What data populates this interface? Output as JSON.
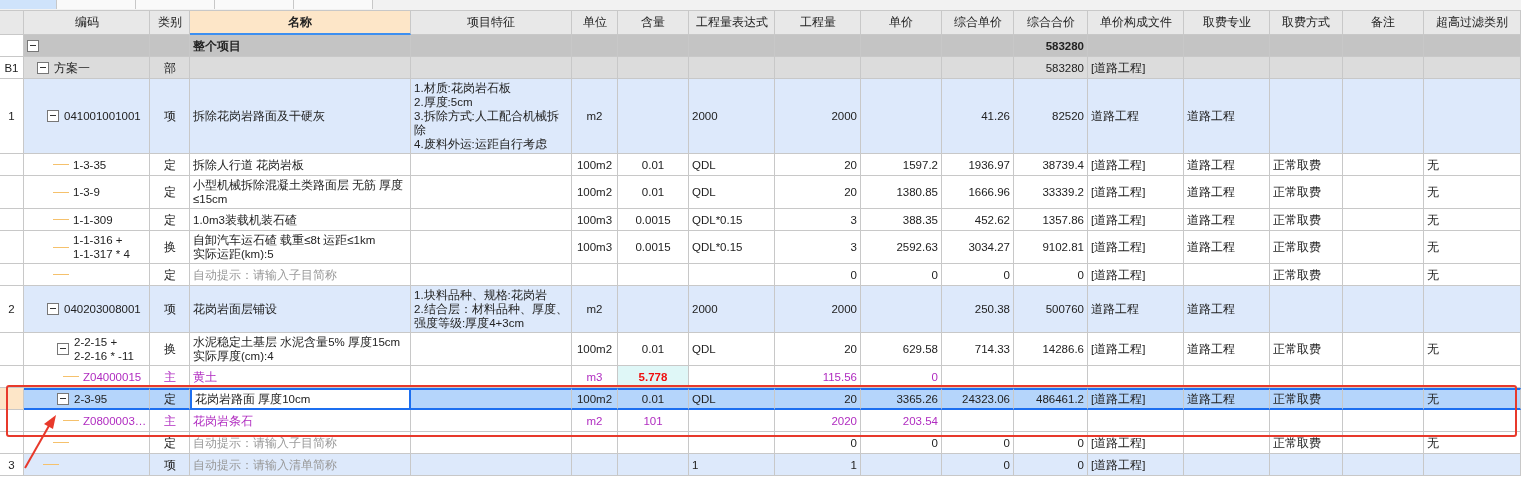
{
  "tabs": [
    {
      "selected": true
    },
    {
      "selected": false
    },
    {
      "selected": false
    },
    {
      "selected": false
    },
    {
      "selected": false
    }
  ],
  "columns": [
    {
      "selected": false
    },
    {
      "label": "编码",
      "selected": false
    },
    {
      "label": "类别",
      "selected": false
    },
    {
      "label": "名称",
      "selected": true
    },
    {
      "label": "项目特征",
      "selected": false
    },
    {
      "label": "单位",
      "selected": false
    },
    {
      "label": "含量",
      "selected": false
    },
    {
      "label": "工程量表达式",
      "selected": false
    },
    {
      "label": "工程量",
      "selected": false
    },
    {
      "label": "单价",
      "selected": false
    },
    {
      "label": "综合单价",
      "selected": false
    },
    {
      "label": "综合合价",
      "selected": false
    },
    {
      "label": "单价构成文件",
      "selected": false
    },
    {
      "label": "取费专业",
      "selected": false
    },
    {
      "label": "取费方式",
      "selected": false
    },
    {
      "label": "备注",
      "selected": false
    },
    {
      "label": "超高过滤类别",
      "selected": false
    }
  ],
  "rows": [
    {
      "kind": "total",
      "name": "整个项目",
      "composite_total": "583280",
      "expanded": true,
      "selected": false,
      "marked": false,
      "content_modified": false,
      "children": [
        {
          "kind": "section",
          "num": "B1",
          "code": "方案一",
          "type": "部",
          "composite_total": "583280",
          "price_file": "[道路工程]",
          "expanded": true,
          "selected": false,
          "marked": false,
          "content_modified": false,
          "children": [
            {
              "kind": "item",
              "num": "1",
              "code": "041001001001",
              "type": "项",
              "name": "拆除花岗岩路面及干硬灰",
              "features": "1.材质:花岗岩石板\n2.厚度:5cm\n3.拆除方式:人工配合机械拆除\n4.废料外运:运距自行考虑",
              "unit": "m2",
              "expr": "2000",
              "qty": "2000",
              "composite_price": "41.26",
              "composite_total": "82520",
              "price_file": "道路工程",
              "fee_major": "道路工程",
              "expanded": true,
              "selected": false,
              "marked": false,
              "content_modified": false,
              "children": [
                {
                  "kind": "quota",
                  "code": "1-3-35",
                  "type": "定",
                  "name": "拆除人行道 花岗岩板",
                  "unit": "100m2",
                  "content": "0.01",
                  "expr": "QDL",
                  "qty": "20",
                  "price": "1597.2",
                  "composite_price": "1936.97",
                  "composite_total": "38739.4",
                  "price_file": "[道路工程]",
                  "fee_major": "道路工程",
                  "fee_mode": "正常取费",
                  "filter": "无",
                  "selected": false,
                  "marked": false,
                  "content_modified": false
                },
                {
                  "kind": "quota",
                  "code": "1-3-9",
                  "type": "定",
                  "name": "小型机械拆除混凝土类路面层 无筋 厚度≤15cm",
                  "unit": "100m2",
                  "content": "0.01",
                  "expr": "QDL",
                  "qty": "20",
                  "price": "1380.85",
                  "composite_price": "1666.96",
                  "composite_total": "33339.2",
                  "price_file": "[道路工程]",
                  "fee_major": "道路工程",
                  "fee_mode": "正常取费",
                  "filter": "无",
                  "selected": false,
                  "marked": false,
                  "content_modified": false
                },
                {
                  "kind": "quota",
                  "code": "1-1-309",
                  "type": "定",
                  "name": "1.0m3装载机装石碴",
                  "unit": "100m3",
                  "content": "0.0015",
                  "expr": "QDL*0.15",
                  "qty": "3",
                  "price": "388.35",
                  "composite_price": "452.62",
                  "composite_total": "1357.86",
                  "price_file": "[道路工程]",
                  "fee_major": "道路工程",
                  "fee_mode": "正常取费",
                  "filter": "无",
                  "selected": false,
                  "marked": false,
                  "content_modified": false
                },
                {
                  "kind": "quota",
                  "code": "1-1-316 +\n1-1-317 * 4",
                  "type": "换",
                  "name": "自卸汽车运石碴 载重≤8t 运距≤1km\n实际运距(km):5",
                  "unit": "100m3",
                  "content": "0.0015",
                  "expr": "QDL*0.15",
                  "qty": "3",
                  "price": "2592.63",
                  "composite_price": "3034.27",
                  "composite_total": "9102.81",
                  "price_file": "[道路工程]",
                  "fee_major": "道路工程",
                  "fee_mode": "正常取费",
                  "filter": "无",
                  "selected": false,
                  "marked": false,
                  "content_modified": false
                },
                {
                  "kind": "quota",
                  "type": "定",
                  "placeholder": "自动提示：请输入子目简称",
                  "qty": "0",
                  "price": "0",
                  "composite_price": "0",
                  "composite_total": "0",
                  "price_file": "[道路工程]",
                  "fee_mode": "正常取费",
                  "filter": "无",
                  "selected": false,
                  "marked": false,
                  "content_modified": false
                }
              ]
            },
            {
              "kind": "item",
              "num": "2",
              "code": "040203008001",
              "type": "项",
              "name": "花岗岩面层铺设",
              "features": "1.块料品种、规格:花岗岩\n2.结合层：材料品种、厚度、强度等级:厚度4+3cm",
              "unit": "m2",
              "expr": "2000",
              "qty": "2000",
              "composite_price": "250.38",
              "composite_total": "500760",
              "price_file": "道路工程",
              "fee_major": "道路工程",
              "expanded": true,
              "selected": false,
              "marked": false,
              "content_modified": false,
              "children": [
                {
                  "kind": "quota",
                  "code": "2-2-15 +\n2-2-16 * -11",
                  "type": "换",
                  "name": "水泥稳定土基层 水泥含量5% 厚度15cm\n实际厚度(cm):4",
                  "unit": "100m2",
                  "content": "0.01",
                  "expr": "QDL",
                  "qty": "20",
                  "price": "629.58",
                  "composite_price": "714.33",
                  "composite_total": "14286.6",
                  "price_file": "[道路工程]",
                  "fee_major": "道路工程",
                  "fee_mode": "正常取费",
                  "filter": "无",
                  "expanded": true,
                  "selected": false,
                  "marked": false,
                  "content_modified": false,
                  "children": [
                    {
                      "kind": "material",
                      "code": "Z04000015",
                      "type": "主",
                      "name": "黄土",
                      "unit": "m3",
                      "content": "5.778",
                      "qty": "115.56",
                      "price": "0",
                      "selected": false,
                      "marked": false,
                      "content_modified": true
                    }
                  ]
                },
                {
                  "kind": "quota",
                  "code": "2-3-95",
                  "type": "定",
                  "name": "花岗岩路面 厚度10cm",
                  "unit": "100m2",
                  "content": "0.01",
                  "expr": "QDL",
                  "qty": "20",
                  "price": "3365.26",
                  "composite_price": "24323.06",
                  "composite_total": "486461.2",
                  "price_file": "[道路工程]",
                  "fee_major": "道路工程",
                  "fee_mode": "正常取费",
                  "filter": "无",
                  "expanded": true,
                  "selected": true,
                  "marked": true,
                  "content_modified": false,
                  "children": [
                    {
                      "kind": "material",
                      "code": "Z0800003…",
                      "type": "主",
                      "name": "花岗岩条石",
                      "unit": "m2",
                      "content": "101",
                      "qty": "2020",
                      "price": "203.54",
                      "selected": false,
                      "marked": false,
                      "content_modified": false
                    }
                  ]
                },
                {
                  "kind": "quota",
                  "type": "定",
                  "placeholder": "自动提示：请输入子目简称",
                  "qty": "0",
                  "price": "0",
                  "composite_price": "0",
                  "composite_total": "0",
                  "price_file": "[道路工程]",
                  "fee_mode": "正常取费",
                  "filter": "无",
                  "selected": false,
                  "marked": false,
                  "content_modified": false
                }
              ]
            },
            {
              "kind": "item",
              "num": "3",
              "type": "项",
              "placeholder": "自动提示：请输入清单简称",
              "expr": "1",
              "qty": "1",
              "composite_price": "0",
              "composite_total": "0",
              "price_file": "[道路工程]",
              "selected": false,
              "marked": false,
              "content_modified": false
            }
          ]
        }
      ]
    }
  ]
}
